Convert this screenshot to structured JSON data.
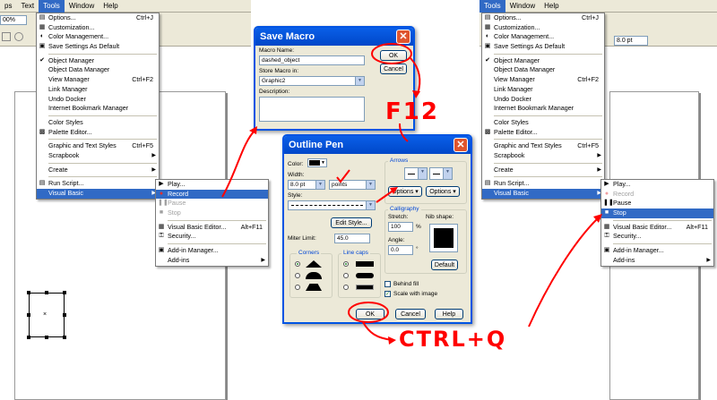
{
  "left_app": {
    "menubar": [
      "ps",
      "Text",
      "Tools",
      "Window",
      "Help"
    ],
    "zoom": "00%",
    "tools_menu": [
      {
        "label": "Options...",
        "shortcut": "Ctrl+J",
        "icon": "options-icon"
      },
      {
        "label": "Customization...",
        "icon": "customize-icon"
      },
      {
        "label": "Color Management...",
        "icon": "color-management-icon"
      },
      {
        "label": "Save Settings As Default",
        "icon": "save-settings-icon"
      },
      {
        "sep": true
      },
      {
        "label": "Object Manager",
        "check": true
      },
      {
        "label": "Object Data Manager"
      },
      {
        "label": "View Manager",
        "shortcut": "Ctrl+F2"
      },
      {
        "label": "Link Manager"
      },
      {
        "label": "Undo Docker"
      },
      {
        "label": "Internet Bookmark Manager"
      },
      {
        "sep": true
      },
      {
        "label": "Color Styles"
      },
      {
        "label": "Palette Editor...",
        "icon": "palette-icon"
      },
      {
        "sep": true
      },
      {
        "label": "Graphic and Text Styles",
        "shortcut": "Ctrl+F5"
      },
      {
        "label": "Scrapbook",
        "submenu": true
      },
      {
        "sep": true
      },
      {
        "label": "Create",
        "submenu": true
      },
      {
        "sep": true
      },
      {
        "label": "Run Script...",
        "icon": "script-icon"
      },
      {
        "label": "Visual Basic",
        "submenu": true,
        "highlight": true
      }
    ],
    "vb_menu": [
      {
        "label": "Play...",
        "icon": "play-icon"
      },
      {
        "label": "Record",
        "icon": "record-icon",
        "highlight": true
      },
      {
        "label": "Pause",
        "icon": "pause-icon",
        "dim": true
      },
      {
        "label": "Stop",
        "icon": "stop-icon",
        "dim": true
      },
      {
        "sep": true
      },
      {
        "label": "Visual Basic Editor...",
        "shortcut": "Alt+F11",
        "icon": "vb-editor-icon"
      },
      {
        "label": "Security...",
        "icon": "security-icon"
      },
      {
        "sep": true
      },
      {
        "label": "Add-in Manager...",
        "icon": "addin-icon"
      },
      {
        "label": "Add-ins",
        "submenu": true
      }
    ]
  },
  "save_macro": {
    "title": "Save Macro",
    "macro_name_label": "Macro Name:",
    "macro_name_value": "dashed_object",
    "store_label": "Store Macro in:",
    "store_value": "Graphic2",
    "description_label": "Description:",
    "ok": "OK",
    "cancel": "Cancel"
  },
  "outline_pen": {
    "title": "Outline Pen",
    "color_label": "Color:",
    "width_label": "Width:",
    "width_value": "8.0 pt",
    "units_value": "points",
    "style_label": "Style:",
    "edit_style": "Edit Style...",
    "miter_label": "Miter Limit:",
    "miter_value": "45.0",
    "corners_label": "Corners",
    "linecaps_label": "Line caps",
    "arrows_label": "Arrows",
    "options1": "Options",
    "options2": "Options",
    "calligraphy_label": "Calligraphy",
    "stretch_label": "Stretch:",
    "stretch_value": "100",
    "stretch_unit": "%",
    "angle_label": "Angle:",
    "angle_value": "0.0",
    "angle_unit": "°",
    "nib_label": "Nib shape:",
    "default_btn": "Default",
    "behind_fill": "Behind fill",
    "scale_image": "Scale with image",
    "ok": "OK",
    "cancel": "Cancel",
    "help": "Help"
  },
  "right_app": {
    "menubar": [
      "Tools",
      "Window",
      "Help"
    ],
    "width_value": "8.0 pt",
    "tools_menu": [
      {
        "label": "Options...",
        "shortcut": "Ctrl+J",
        "icon": "options-icon"
      },
      {
        "label": "Customization...",
        "icon": "customize-icon"
      },
      {
        "label": "Color Management...",
        "icon": "color-management-icon"
      },
      {
        "label": "Save Settings As Default",
        "icon": "save-settings-icon"
      },
      {
        "sep": true
      },
      {
        "label": "Object Manager",
        "check": true
      },
      {
        "label": "Object Data Manager"
      },
      {
        "label": "View Manager",
        "shortcut": "Ctrl+F2"
      },
      {
        "label": "Link Manager"
      },
      {
        "label": "Undo Docker"
      },
      {
        "label": "Internet Bookmark Manager"
      },
      {
        "sep": true
      },
      {
        "label": "Color Styles"
      },
      {
        "label": "Palette Editor...",
        "icon": "palette-icon"
      },
      {
        "sep": true
      },
      {
        "label": "Graphic and Text Styles",
        "shortcut": "Ctrl+F5"
      },
      {
        "label": "Scrapbook",
        "submenu": true
      },
      {
        "sep": true
      },
      {
        "label": "Create",
        "submenu": true
      },
      {
        "sep": true
      },
      {
        "label": "Run Script...",
        "icon": "script-icon"
      },
      {
        "label": "Visual Basic",
        "submenu": true,
        "highlight": true
      }
    ],
    "vb_menu": [
      {
        "label": "Play...",
        "icon": "play-icon"
      },
      {
        "label": "Record",
        "icon": "record-icon",
        "dim": true
      },
      {
        "label": "Pause",
        "icon": "pause-icon"
      },
      {
        "label": "Stop",
        "icon": "stop-icon",
        "highlight": true
      },
      {
        "sep": true
      },
      {
        "label": "Visual Basic Editor...",
        "shortcut": "Alt+F11",
        "icon": "vb-editor-icon"
      },
      {
        "label": "Security...",
        "icon": "security-icon"
      },
      {
        "sep": true
      },
      {
        "label": "Add-in Manager...",
        "icon": "addin-icon"
      },
      {
        "label": "Add-ins",
        "submenu": true
      }
    ]
  },
  "annotations": {
    "f12": "F12",
    "ctrl_q": "CTRL+Q"
  },
  "colors": {
    "highlight": "#316ac5",
    "annotation": "#ff0000",
    "title_bar": "#0054e3"
  }
}
